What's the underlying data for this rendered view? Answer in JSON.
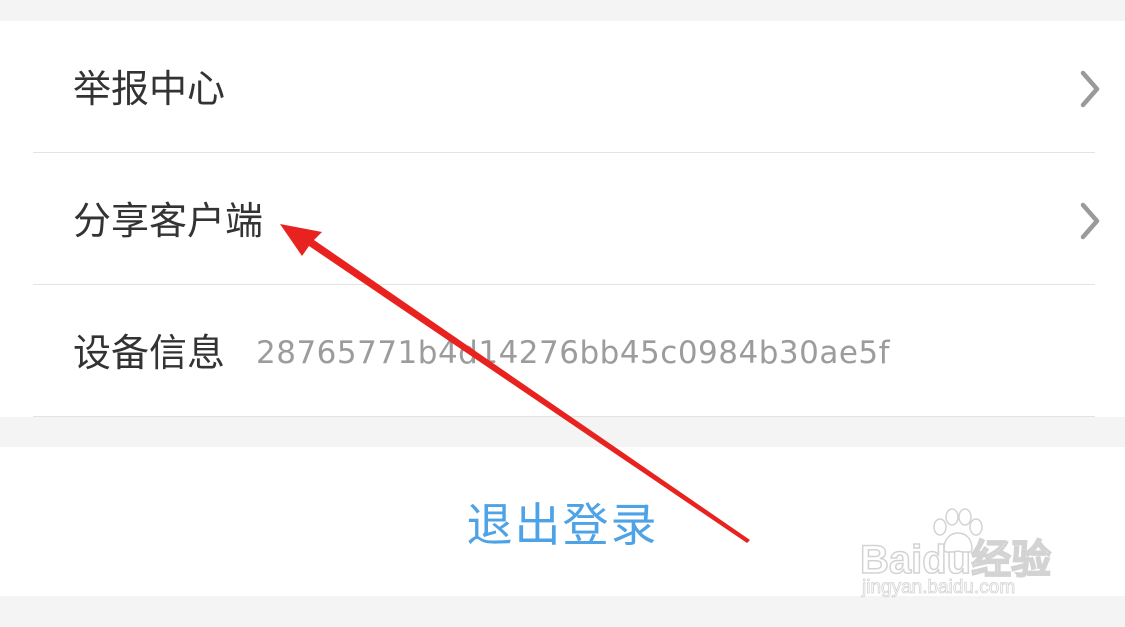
{
  "settings": {
    "rows": [
      {
        "label": "举报中心",
        "has_chevron": true
      },
      {
        "label": "分享客户端",
        "has_chevron": true
      },
      {
        "label": "设备信息",
        "value": "28765771b4d14276bb45c0984b30ae5f",
        "has_chevron": false
      }
    ]
  },
  "logout": {
    "label": "退出登录"
  },
  "icons": {
    "chevron": "chevron-right-icon",
    "annotation": "red-arrow-annotation"
  },
  "watermark": {
    "logo": "Baidu经验",
    "url": "jingyan.baidu.com"
  },
  "colors": {
    "accent": "#4ea3e6",
    "annotation": "#e8231f",
    "label": "#333333",
    "secondary": "#9c9c9c",
    "chevron": "#9a9a9a",
    "background": "#f4f4f4"
  }
}
